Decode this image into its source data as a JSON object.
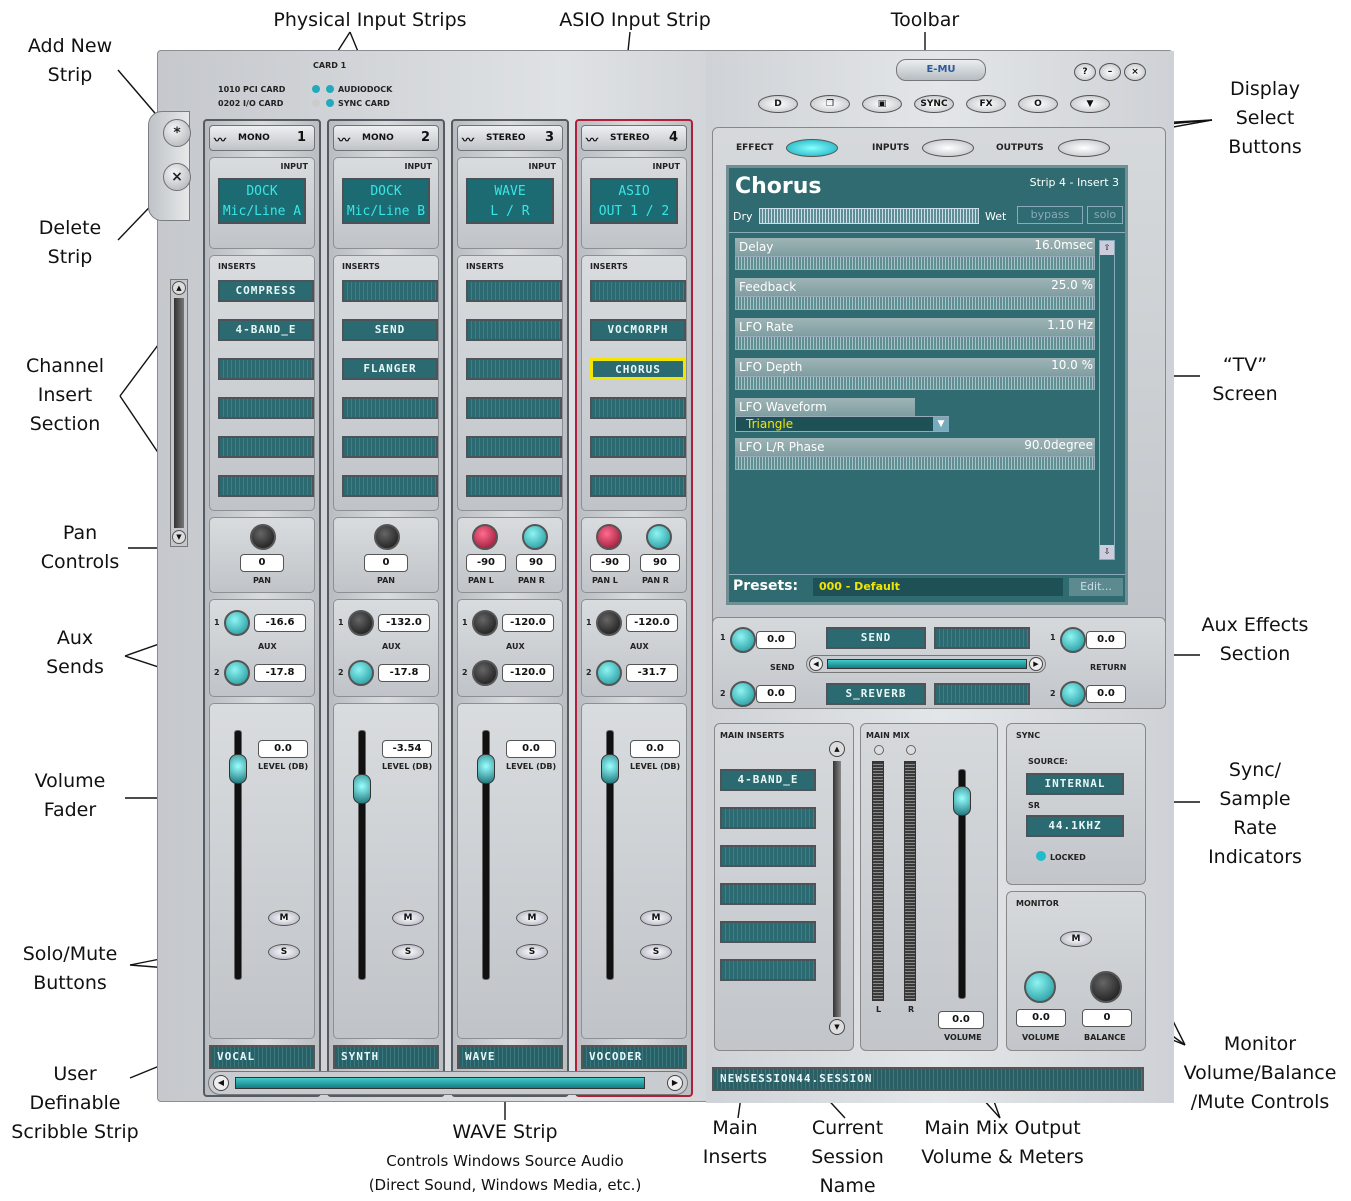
{
  "callouts": {
    "top": {
      "physical_input_strips": "Physical Input Strips",
      "asio_input_strip": "ASIO Input Strip",
      "toolbar": "Toolbar"
    },
    "left": {
      "add_new_strip": "Add New Strip",
      "delete_strip": "Delete Strip",
      "channel_insert_section": "Channel Insert Section",
      "pan_controls": "Pan Controls",
      "aux_sends": "Aux Sends",
      "volume_fader": "Volume Fader",
      "solo_mute_buttons": "Solo/Mute Buttons",
      "user_scribble_strip": "User Definable Scribble Strip"
    },
    "right": {
      "display_select_buttons": "Display Select Buttons",
      "tv_screen": "“TV” Screen",
      "aux_effects_section": "Aux Effects Section",
      "sync_indicators": "Sync/ Sample Rate Indicators",
      "monitor_controls": "Monitor Volume/Balance /Mute Controls"
    },
    "bottom": {
      "wave_strip": "WAVE Strip",
      "wave_sub1": "Controls Windows Source Audio",
      "wave_sub2": "(Direct Sound, Windows Media, etc.)",
      "main_inserts": "Main Inserts",
      "current_session": "Current Session Name",
      "main_mix": "Main Mix Output Volume & Meters"
    }
  },
  "card": {
    "title": "CARD 1",
    "line1a": "1010 PCI CARD",
    "line1b": "AUDIODOCK",
    "line2a": "0202 I/O CARD",
    "line2b": "SYNC CARD"
  },
  "side": {
    "add": "*",
    "delete": "×"
  },
  "strips": [
    {
      "type": "MONO",
      "num": "1",
      "input1": "DOCK",
      "input2": "Mic/Line A",
      "inserts": [
        "COMPRESS",
        "4-BAND_E",
        "",
        "",
        "",
        ""
      ],
      "pan": [
        "0"
      ],
      "pan_labels": [
        "PAN"
      ],
      "aux1": "-16.6",
      "aux2": "-17.8",
      "level": "0.0",
      "scribble": "VOCAL"
    },
    {
      "type": "MONO",
      "num": "2",
      "input1": "DOCK",
      "input2": "Mic/Line B",
      "inserts": [
        "",
        "SEND",
        "FLANGER",
        "",
        "",
        ""
      ],
      "pan": [
        "0"
      ],
      "pan_labels": [
        "PAN"
      ],
      "aux1": "-132.0",
      "aux2": "-17.8",
      "level": "-3.54",
      "scribble": "SYNTH"
    },
    {
      "type": "STEREO",
      "num": "3",
      "input1": "WAVE",
      "input2": "L / R",
      "inserts": [
        "",
        "",
        "",
        "",
        "",
        ""
      ],
      "pan": [
        "-90",
        "90"
      ],
      "pan_labels": [
        "PAN L",
        "PAN R"
      ],
      "aux1": "-120.0",
      "aux2": "-120.0",
      "level": "0.0",
      "scribble": "WAVE"
    },
    {
      "type": "STEREO",
      "num": "4",
      "input1": "ASIO",
      "input2": "OUT 1 / 2",
      "inserts": [
        "",
        "VOCMORPH",
        "CHORUS",
        "",
        "",
        ""
      ],
      "pan": [
        "-90",
        "90"
      ],
      "pan_labels": [
        "PAN L",
        "PAN R"
      ],
      "aux1": "-120.0",
      "aux2": "-31.7",
      "level": "0.0",
      "scribble": "VOCODER"
    }
  ],
  "labels": {
    "input": "INPUT",
    "inserts": "INSERTS",
    "aux": "AUX",
    "level": "LEVEL (DB)",
    "mute": "M",
    "solo": "S"
  },
  "toolbar": {
    "brand": "E-MU",
    "buttons": [
      "D",
      "❐",
      "▣",
      "SYNC",
      "FX",
      "O",
      "▼"
    ],
    "help": "?",
    "min": "–",
    "close": "×"
  },
  "display_select": {
    "effect": "EFFECT",
    "inputs": "INPUTS",
    "outputs": "OUTPUTS"
  },
  "tv": {
    "title": "Chorus",
    "location": "Strip 4 - Insert 3",
    "dry": "Dry",
    "wet": "Wet",
    "bypass": "bypass",
    "solo": "solo",
    "params": [
      {
        "name": "Delay",
        "value": "16.0msec"
      },
      {
        "name": "Feedback",
        "value": "25.0 %"
      },
      {
        "name": "LFO Rate",
        "value": "1.10 Hz"
      },
      {
        "name": "LFO Depth",
        "value": "10.0 %"
      },
      {
        "name": "LFO Waveform",
        "value": "Triangle"
      },
      {
        "name": "LFO L/R Phase",
        "value": "90.0degree"
      }
    ],
    "presets_label": "Presets:",
    "preset": "000 - Default",
    "edit": "Edit..."
  },
  "aux_fx": {
    "send1": "0.0",
    "send2": "0.0",
    "send_label": "SEND",
    "slot1": "SEND",
    "slot2": "S_REVERB",
    "return1": "0.0",
    "return2": "0.0",
    "return_label": "RETURN"
  },
  "main_inserts": {
    "title": "MAIN INSERTS",
    "slots": [
      "4-BAND_E",
      "",
      "",
      "",
      "",
      ""
    ]
  },
  "main_mix": {
    "title": "MAIN MIX",
    "l": "L",
    "r": "R",
    "volume": "0.0",
    "volume_label": "VOLUME"
  },
  "sync": {
    "title": "SYNC",
    "source_label": "SOURCE:",
    "source": "INTERNAL",
    "sr_label": "SR",
    "sr": "44.1KHZ",
    "locked": "LOCKED"
  },
  "monitor": {
    "title": "MONITOR",
    "mute": "M",
    "volume": "0.0",
    "volume_label": "VOLUME",
    "balance": "0",
    "balance_label": "BALANCE"
  },
  "session": "NEWSESSION44.SESSION",
  "colors": {
    "lcd": "#38e6e6",
    "tv_bg": "#2f6b70",
    "selected_insert": "#f2e600",
    "asio_outline": "#b0203a"
  }
}
